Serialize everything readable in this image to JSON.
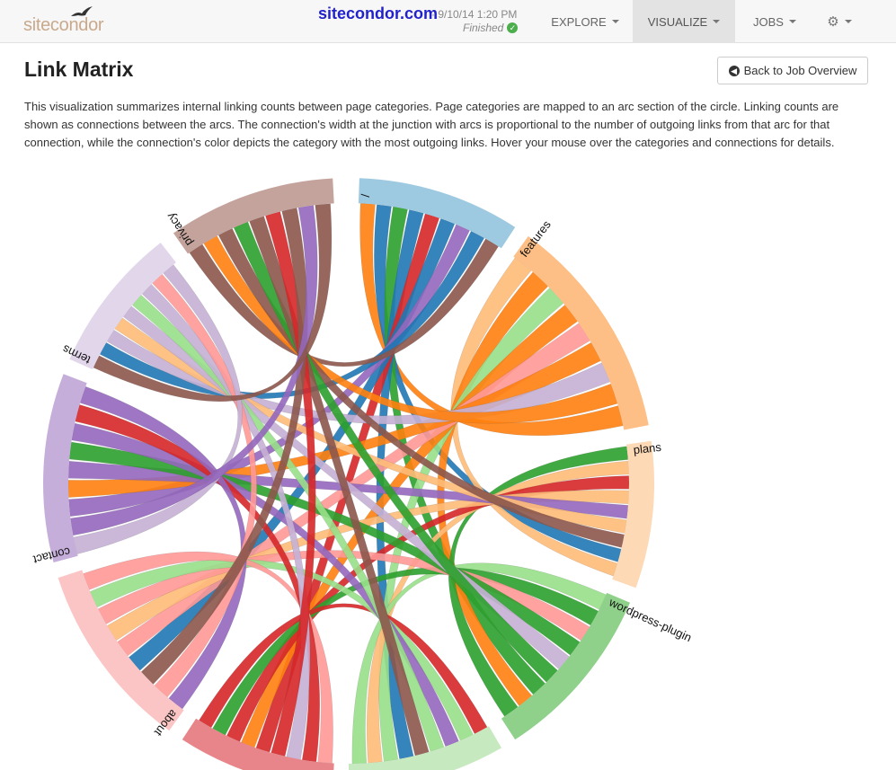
{
  "nav": {
    "brand": "sitecondor",
    "site": "sitecondor.com",
    "timestamp": "· 9/10/14 1:20 PM",
    "status": "Finished",
    "items": [
      "EXPLORE",
      "VISUALIZE",
      "JOBS"
    ],
    "active": "VISUALIZE",
    "settings_icon": "gear-icon"
  },
  "page": {
    "title": "Link Matrix",
    "back_label": "Back to Job Overview",
    "description": "This visualization summarizes internal linking counts between page categories. Page categories are mapped to an arc section of the circle. Linking counts are shown as connections between the arcs. The connection's width at the junction with arcs is proportional to the number of outgoing links from that arc for that connection, while the connection's color depicts the category with the most outgoing links. Hover your mouse over the categories and connections for details."
  },
  "colors": {
    "/": "#1f77b4",
    "features": "#ff7f0e",
    "plans": "#ffbb78",
    "wordpress-plugin": "#2ca02c",
    "blog": "#98df8a",
    "pricing": "#d62728",
    "about": "#ff9896",
    "contact": "#9467bd",
    "terms": "#c5b0d5",
    "privacy": "#8c564b"
  },
  "chart_data": {
    "type": "chord",
    "categories": [
      "/",
      "features",
      "plans",
      "wordpress-plugin",
      "",
      "",
      "about",
      "contact",
      "terms",
      "privacy"
    ],
    "arc_colors": [
      "#9ecae1",
      "#fdbf85",
      "#fdd9b5",
      "#8fd18a",
      "#c7e9c0",
      "#e8858a",
      "#fcc5c5",
      "#c6aedb",
      "#e2d6eb",
      "#c4a39c"
    ],
    "chord_colors": [
      "#1f77b4",
      "#ff7f0e",
      "#ffbb78",
      "#2ca02c",
      "#98df8a",
      "#d62728",
      "#ff9896",
      "#9467bd",
      "#c5b0d5",
      "#8c564b"
    ],
    "arc_spans_deg": [
      [
        2,
        33
      ],
      [
        36,
        79
      ],
      [
        82,
        110
      ],
      [
        113,
        147
      ],
      [
        150,
        180
      ],
      [
        183,
        213
      ],
      [
        216,
        252
      ],
      [
        255,
        291
      ],
      [
        294,
        322
      ],
      [
        325,
        357
      ]
    ]
  }
}
